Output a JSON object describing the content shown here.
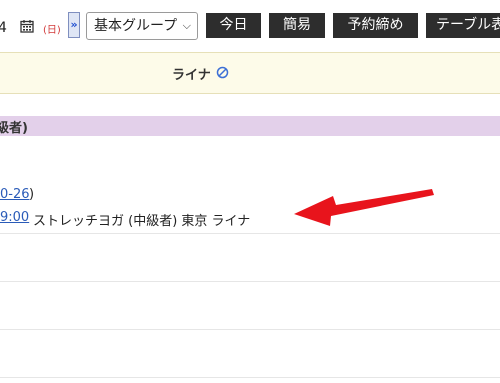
{
  "toolbar": {
    "date_tail": "4",
    "weekday": "(日)",
    "next_label": "»",
    "group_select": "基本グループ",
    "buttons": [
      "今日",
      "簡易",
      "予約締め",
      "テーブル表"
    ]
  },
  "header": {
    "staff_name": "ライナ"
  },
  "lesson": {
    "title": "級者)"
  },
  "reservation": {
    "date_link": "0-26",
    "date_close": ")",
    "time_link": "9:00",
    "description": "ストレッチヨガ (中級者) 東京 ライナ"
  },
  "colors": {
    "header_bg": "#fdfbe9",
    "lesson_bg": "#e3d0ea",
    "link": "#2a5bb8",
    "arrow": "#e8141c",
    "button_bg": "#2d2d2d"
  },
  "icons": {
    "calendar": "calendar-icon",
    "staff": "no-entry-icon",
    "select": "chevron-down-icon"
  }
}
